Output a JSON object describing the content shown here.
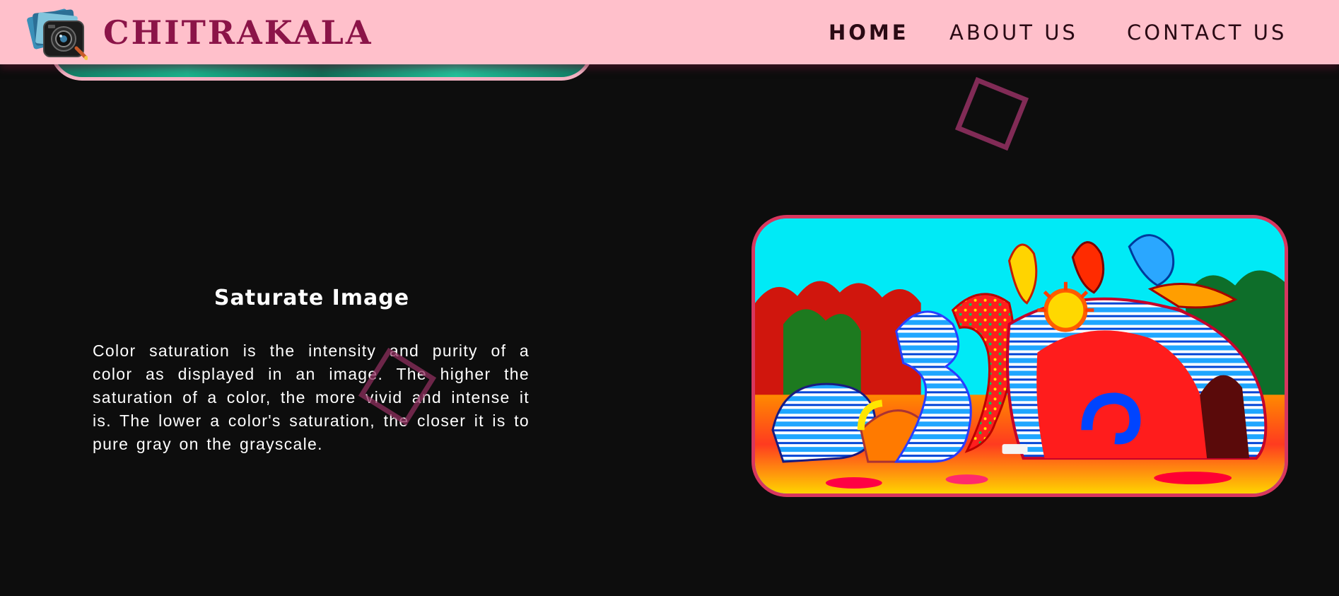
{
  "header": {
    "brand": "CHITRAKALA",
    "logo_icon": "camera-photos-icon",
    "nav": [
      {
        "label": "HOME",
        "active": true
      },
      {
        "label": "ABOUT US",
        "active": false
      },
      {
        "label": "CONTACT US",
        "active": false
      }
    ]
  },
  "section": {
    "title": "Saturate Image",
    "description": "Color saturation is the intensity and purity of a color as displayed in an image. The higher the saturation of a color, the more vivid and intense it is. The lower a color's saturation, the closer it is to pure gray on the grayscale."
  },
  "colors": {
    "header_bg": "#ffc0cb",
    "brand": "#8b1448",
    "page_bg": "#0d0d0d",
    "accent_border": "#d8365e",
    "decor_square": "#8e2f5e"
  }
}
